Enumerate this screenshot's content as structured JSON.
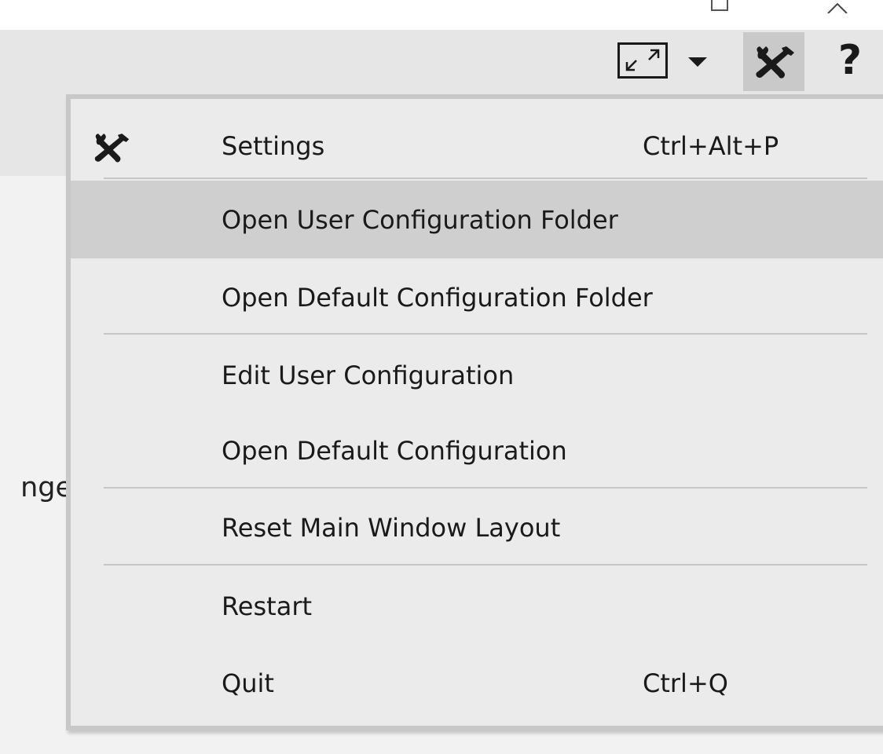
{
  "toolbar": {
    "fullscreen_icon": "fullscreen-expand-icon",
    "dropdown_icon": "caret-down-icon",
    "tools_icon": "tools-wrench-screwdriver-icon",
    "help_label": "?"
  },
  "page": {
    "partial_text": "nge"
  },
  "menu": {
    "items": [
      {
        "label": "Settings",
        "shortcut": "Ctrl+Alt+P",
        "icon": "tools-icon",
        "highlighted": false
      },
      {
        "label": "Open User Configuration Folder",
        "shortcut": "",
        "highlighted": true
      },
      {
        "label": "Open Default Configuration Folder",
        "shortcut": "",
        "highlighted": false
      },
      {
        "label": "Edit User Configuration",
        "shortcut": "",
        "highlighted": false
      },
      {
        "label": "Open Default Configuration",
        "shortcut": "",
        "highlighted": false
      },
      {
        "label": "Reset Main Window Layout",
        "shortcut": "",
        "highlighted": false
      },
      {
        "label": "Restart",
        "shortcut": "",
        "highlighted": false
      },
      {
        "label": "Quit",
        "shortcut": "Ctrl+Q",
        "highlighted": false
      }
    ]
  },
  "colors": {
    "menu_background": "#ebebeb",
    "menu_highlight": "#cfcfcf",
    "toolbar_background": "#e6e6e6",
    "active_button": "#c9c9c9"
  }
}
